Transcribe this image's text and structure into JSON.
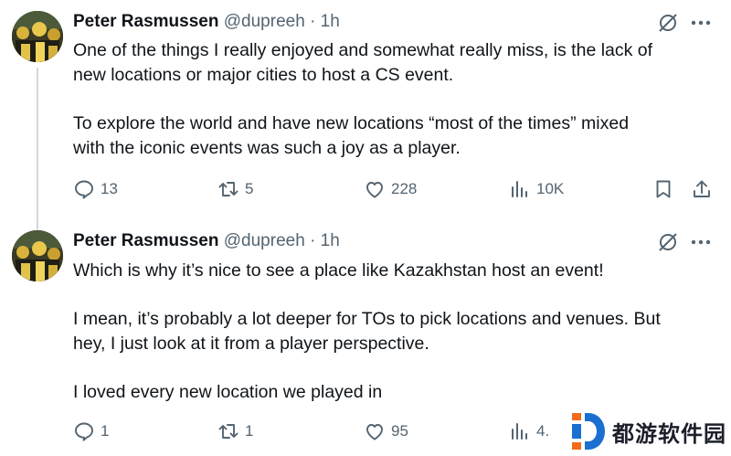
{
  "tweets": [
    {
      "author_name": "Peter Rasmussen",
      "handle": "@dupreeh",
      "time": "· 1h",
      "lines_p1": [
        "One of the things I really enjoyed and somewhat really miss, is the lack of",
        "new locations or major cities to host a CS event."
      ],
      "lines_p2": [
        "To explore the world and have new locations “most of the times” mixed",
        "with the iconic events was such a joy as a player."
      ],
      "replies": "13",
      "reposts": "5",
      "likes": "228",
      "views": "10K"
    },
    {
      "author_name": "Peter Rasmussen",
      "handle": "@dupreeh",
      "time": "· 1h",
      "line_1": "Which is why it’s nice to see a place like Kazakhstan host an event!",
      "line_2a": "I mean, it’s probably a lot deeper for TOs to pick locations and venues. But",
      "line_2b": "hey, I just look at it from a player perspective.",
      "line_3": "I loved every new location we played in",
      "replies": "1",
      "reposts": "1",
      "likes": "95",
      "views": "4."
    }
  ],
  "watermark": {
    "text": "都游软件园",
    "icon": "d-logo-icon"
  },
  "colors": {
    "text": "#0f1419",
    "muted": "#536471",
    "line": "#cfd9de",
    "watermark_orange": "#f26a1b",
    "watermark_blue": "#1a6fd1"
  }
}
